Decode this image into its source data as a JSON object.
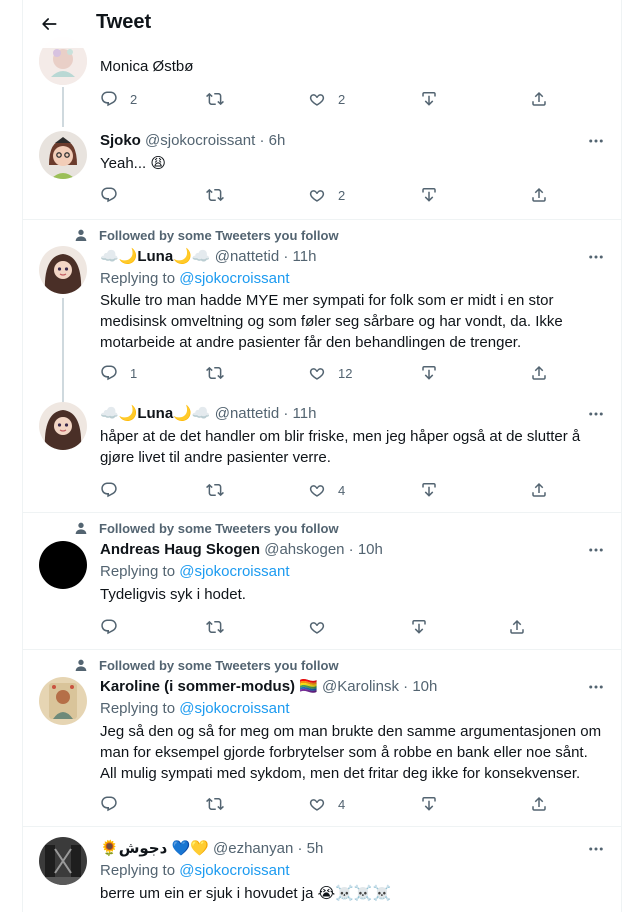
{
  "header": {
    "title": "Tweet"
  },
  "social_context": "Followed by some Tweeters you follow",
  "tweets": [
    {
      "name_partial": "",
      "text": "Monica Østbø",
      "actions": {
        "reply": "2",
        "retweet": "",
        "like": "2"
      }
    },
    {
      "name": "Sjoko",
      "handle": "@sjokocroissant",
      "time": "6h",
      "text": "Yeah... 😩",
      "actions": {
        "reply": "",
        "retweet": "",
        "like": "2"
      }
    },
    {
      "name_prefix": "☁️🌙",
      "name": "Luna",
      "name_suffix": "🌙☁️",
      "handle": "@nattetid",
      "time": "11h",
      "replying_label": "Replying to",
      "replying_to": "@sjokocroissant",
      "text": "Skulle tro man hadde MYE mer sympati for folk som er midt i en stor medisinsk omveltning og som føler seg sårbare og har vondt, da.  Ikke motarbeide at andre pasienter får den behandlingen de trenger.",
      "actions": {
        "reply": "1",
        "retweet": "",
        "like": "12"
      }
    },
    {
      "name_prefix": "☁️🌙",
      "name": "Luna",
      "name_suffix": "🌙☁️",
      "handle": "@nattetid",
      "time": "11h",
      "text": "håper at de det handler om blir friske, men jeg håper også at de slutter å gjøre livet til andre pasienter verre.",
      "actions": {
        "reply": "",
        "retweet": "",
        "like": "4"
      }
    },
    {
      "name": "Andreas Haug Skogen",
      "handle": "@ahskogen",
      "time": "10h",
      "replying_label": "Replying to",
      "replying_to": "@sjokocroissant",
      "text": "Tydeligvis syk i hodet.",
      "actions": {
        "reply": "",
        "retweet": "",
        "like": ""
      }
    },
    {
      "name": "Karoline (i sommer-modus) 🏳️‍🌈",
      "handle": "@Karolinsk",
      "time": "10h",
      "replying_label": "Replying to",
      "replying_to": "@sjokocroissant",
      "text": "Jeg så den og så for meg om man brukte den samme argumentasjonen om man for eksempel gjorde forbrytelser som å robbe en bank eller noe sånt. All mulig sympati med sykdom, men det fritar deg ikke for konsekvenser.",
      "actions": {
        "reply": "",
        "retweet": "",
        "like": "4"
      }
    },
    {
      "name": "🌻دجوش 💙💛",
      "handle": "@ezhanyan",
      "time": "5h",
      "replying_label": "Replying to",
      "replying_to": "@sjokocroissant",
      "text": "berre um ein er sjuk i hovudet ja 😭☠️☠️☠️"
    }
  ],
  "colors": {
    "accent": "#1d9bf0",
    "secondary_text": "#536471",
    "divider": "#eff3f4"
  },
  "icons": [
    "back-arrow-icon",
    "more-icon",
    "reply-icon",
    "retweet-icon",
    "like-icon",
    "bookmark-icon",
    "share-icon",
    "person-icon"
  ]
}
